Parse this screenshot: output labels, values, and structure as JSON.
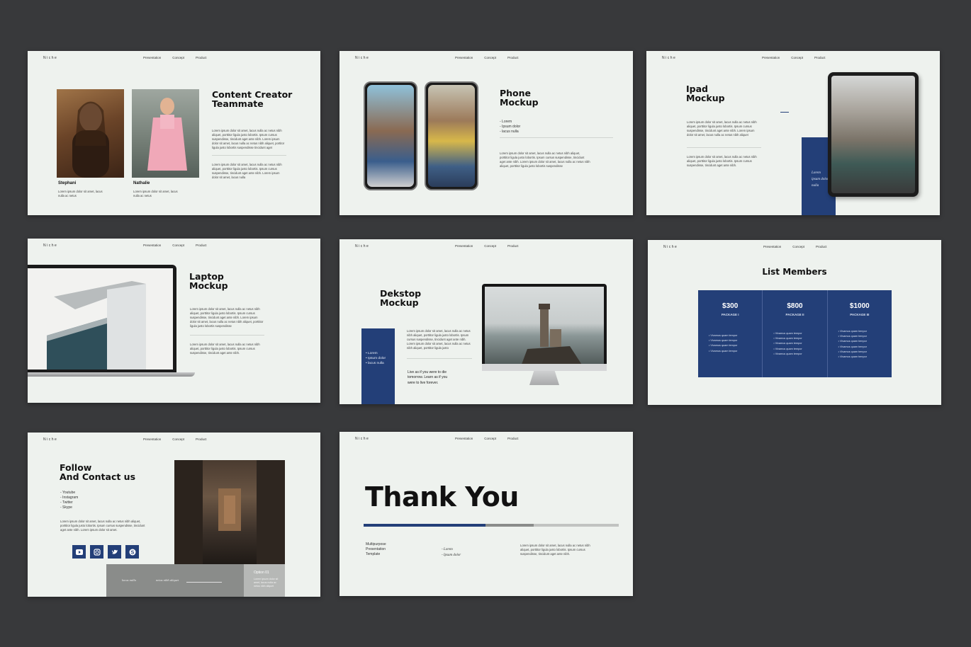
{
  "nav": {
    "brand": "Niche",
    "links": [
      "Presentation",
      "Concept",
      "Product"
    ]
  },
  "slide1": {
    "title_line1": "Content Creator",
    "title_line2": "Teammate",
    "para1": "Lorem ipsum dolor sit amet, lacus nulla ac netus nibh aliquet, porttitor ligula justo lobortis. Ipsum cursus suspendisse, tincidunt aget ante nibh. Lorem ipsum dolor sit amet, lacus nulla ac netus nibh aliquet, portitor ligula justo lobortis suspendisse tincidunt aget",
    "para2": "Lorem ipsum dolor sit amet, lacus nulla ac netus nibh aliquet, porttitor ligula justo lobortis. Ipsum cursus suspendisse, tincidunt aget ante nibh. Lorem ipsum dolor sit amet, lacus nulla",
    "person1_name": "Stephani",
    "person1_desc": "Lorem ipsum dolor sit amet, lacus nulla ac netus",
    "person2_name": "Nathalie",
    "person2_desc": "Lorem ipsum dolor sit amet, lacus nulla ac netus"
  },
  "slide2": {
    "title_line1": "Phone",
    "title_line2": "Mockup",
    "list": [
      "- Lorem",
      "- Ipsum dolor",
      "- lacus nulla"
    ],
    "para": "Lorem ipsum dolor sit amet, lacus nulla ac netus nibh aliquet, porttitor ligula justo lobortis. Ipsum cursus suspendisse, tincidunt aget ante nibh. Lorem ipsum dolor sit amet, lacus nulla ac netus nibh aliquet, porttitor ligula justo lobortis suspendisse"
  },
  "slide3": {
    "title_line1": "Ipad",
    "title_line2": "Mockup",
    "para1": "Lorem ipsum dolor sit amet, lacus nulla ac netus nibh aliquet, porttitor ligula justo lobortis. Ipsum cursus suspendisse, tincidunt aget ante nibh. Lorem ipsum dolor sit amet, lacus nulla ac netus nibh aliquet",
    "para2": "Lorem ipsum dolor sit amet, lacus nulla ac netus nibh aliquet, porttitor ligula justo lobortis. Ipsum cursus suspendisse, tincidunt aget ante nibh.",
    "block_text": [
      "Lorem",
      "ipsum dolor",
      "nulla"
    ]
  },
  "slide4": {
    "title_line1": "Laptop",
    "title_line2": "Mockup",
    "para1": "Lorem ipsum dolor sit amet, lacus nulla ac netus nibh aliquet, porttitor ligula justo lobortis. Ipsum cursus suspendisse, tincidunt aget ante nibh. Lorem ipsum dolor sit amet, lacus nulla ac netus nibh aliquet, porttitor ligula justo lobortis suspendisse",
    "para2": "Lorem ipsum dolor sit amet, lacus nulla ac netus nibh aliquet, porttitor ligula justo lobortis. Ipsum cursus suspendisse, tincidunt aget ante nibh."
  },
  "slide5": {
    "title_line1": "Dekstop",
    "title_line2": "Mockup",
    "block_list": [
      "• Lorem",
      "• Ipsum dolor",
      "• lacus nulla"
    ],
    "para": "Lorem ipsum dolor sit amet, lacus nulla ac netus nibh aliquet, porttitor ligula justo lobortis. Ipsum cursus suspendisse, tincidunt aget ante nibh. Lorem ipsum dolor sit amet, lacus nulla ac netus nibh aliquet, porttitor ligula justo",
    "quote": "Live as if you were to die tomorrow. Learn as if you were to live forever."
  },
  "slide6": {
    "title": "List Members",
    "packages": [
      {
        "price": "$300",
        "name": "PACKAGE I"
      },
      {
        "price": "$800",
        "name": "PACKAGE II"
      },
      {
        "price": "$1000",
        "name": "PACKAGE III"
      }
    ],
    "features": [
      "Vivamus quam tempor",
      "Vivamus quam tempor",
      "Vivamus quam tempor",
      "Vivamus quam tempor",
      "Vivamus quam tempor",
      "Vivamus quam tempor"
    ]
  },
  "slide7": {
    "title_line1": "Follow",
    "title_line2": "And Contact us",
    "list": [
      "- Youtube",
      "- Instagram",
      "- Twitter",
      "- Skype"
    ],
    "para": "Lorem ipsum dolor sit amet, lacus nulla ac netus nibh aliquet, porttitor ligula justo lobortis. Ipsum cursus suspendisse, tincidunt aget ante nibh. Lorem ipsum dolor sit amet.",
    "bar_text1": "lacus nulla",
    "bar_text2": "netus nibh aliquet",
    "option_title": "Option 01",
    "option_text": "Lorem ipsum dolor sit amet, lacus nulla ac netus nibh aliquet"
  },
  "slide8": {
    "title": "Thank You",
    "sub": [
      "Multipurpose",
      "Presentation",
      "Template"
    ],
    "mid": [
      "- Lorem",
      "- Ipsum dolor"
    ],
    "para": "Lorem ipsum dolor sit amet, lacus nulla ac netus nibh aliquet, porttitor ligula justo lobortis. Ipsum cursus suspendisse, tincidunt aget ante nibh."
  },
  "colors": {
    "navy": "#233f78",
    "slide_bg": "#eef2ee",
    "page_bg": "#38393b",
    "gray": "#8a8c8a"
  }
}
